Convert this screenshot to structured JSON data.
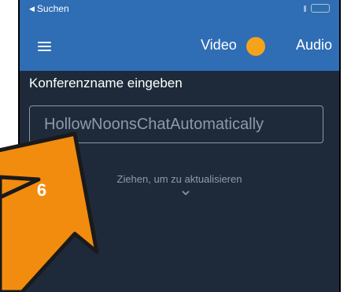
{
  "status_bar": {
    "back_label": "Suchen"
  },
  "toolbar": {
    "menu_icon": "hamburger-icon",
    "video_label": "Video",
    "audio_label": "Audio",
    "mode_toggle_on": false
  },
  "form": {
    "label": "Konferenzname eingeben",
    "placeholder": "HollowNoonsChatAutomatically"
  },
  "pull_hint": "Ziehen, um zu aktualisieren",
  "annotation": {
    "step_number": "6"
  },
  "colors": {
    "app_bar": "#2f6db5",
    "background": "#1e2a3a",
    "accent": "#f5a31a",
    "annotation_arrow": "#f28c0f"
  }
}
